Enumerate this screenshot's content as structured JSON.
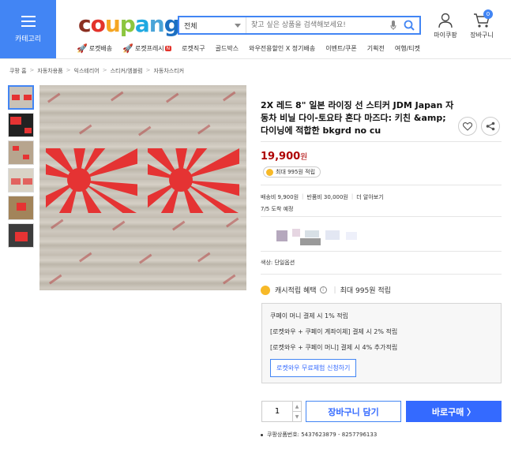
{
  "header": {
    "category_label": "카테고리",
    "logo_letters": [
      "c",
      "o",
      "u",
      "p",
      "a",
      "n",
      "g"
    ],
    "search": {
      "category": "전체",
      "placeholder": "찾고 싶은 상품을 검색해보세요!"
    },
    "mypage_label": "마이쿠팡",
    "cart_label": "장바구니",
    "cart_count": "0"
  },
  "nav": {
    "items": [
      "로켓배송",
      "로켓프레시",
      "로켓직구",
      "골드박스",
      "와우전용할인 X 정기배송",
      "이벤트/쿠폰",
      "기획전",
      "여행/티켓"
    ],
    "new_badge": "N"
  },
  "breadcrumb": [
    "쿠팡 홈",
    "자동차용품",
    "익스테리어",
    "스티커/엠블럼",
    "자동차스티커"
  ],
  "product": {
    "title": "2X 레드 8\" 일본 라이징 선 스티커 JDM Japan 자동차 비닐 다이-토요타 혼다 마즈다: 키친 &amp; 다이닝에 적합한 bkgrd no cu",
    "price": "19,900",
    "price_unit": "원",
    "reward_pill": "최대 995원 적립",
    "shipping": [
      "배송비 9,900원",
      "반품비 30,000원",
      "더 알아보기"
    ],
    "arrival": "7/5 도착 예정",
    "option": "색상: 단일옵션",
    "cash_label": "캐시적립 혜택",
    "cash_info_icon": "i",
    "cash_value": "최대 995원 적립",
    "benefits": [
      "쿠페이 머니 결제 시 1% 적립",
      "[로켓와우 + 쿠페이 계좌이체] 결제 시 2% 적립",
      "[로켓와우 + 쿠페이 머니] 결제 시 4% 추가적립"
    ],
    "apply_button": "로켓와우 무료체험 신청하기",
    "quantity": "1",
    "cart_button": "장바구니 담기",
    "buy_button": "바로구매 〉",
    "product_number": "쿠팡상품번호: 5437623879 - 8257796133"
  },
  "colors": {
    "brand_blue": "#4285f4",
    "buy_blue": "#346aff",
    "price_red": "#ae0000",
    "flag_red": "#e53333"
  }
}
